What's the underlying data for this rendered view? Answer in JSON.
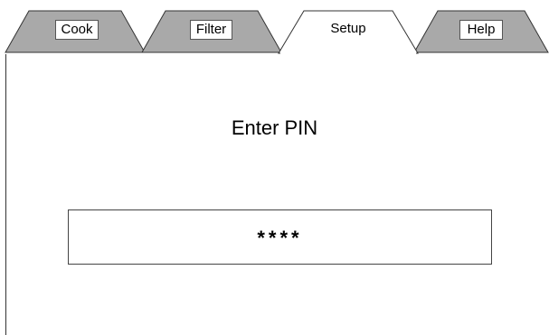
{
  "tabs": {
    "cook": "Cook",
    "filter": "Filter",
    "setup": "Setup",
    "help": "Help",
    "active": "Setup"
  },
  "colors": {
    "tab_fill": "#a9a9a9",
    "active_tab_fill": "#ffffff",
    "outline": "#333333",
    "background": "#ffffff"
  },
  "prompt": {
    "title": "Enter PIN"
  },
  "pin": {
    "masked_value": "****"
  }
}
